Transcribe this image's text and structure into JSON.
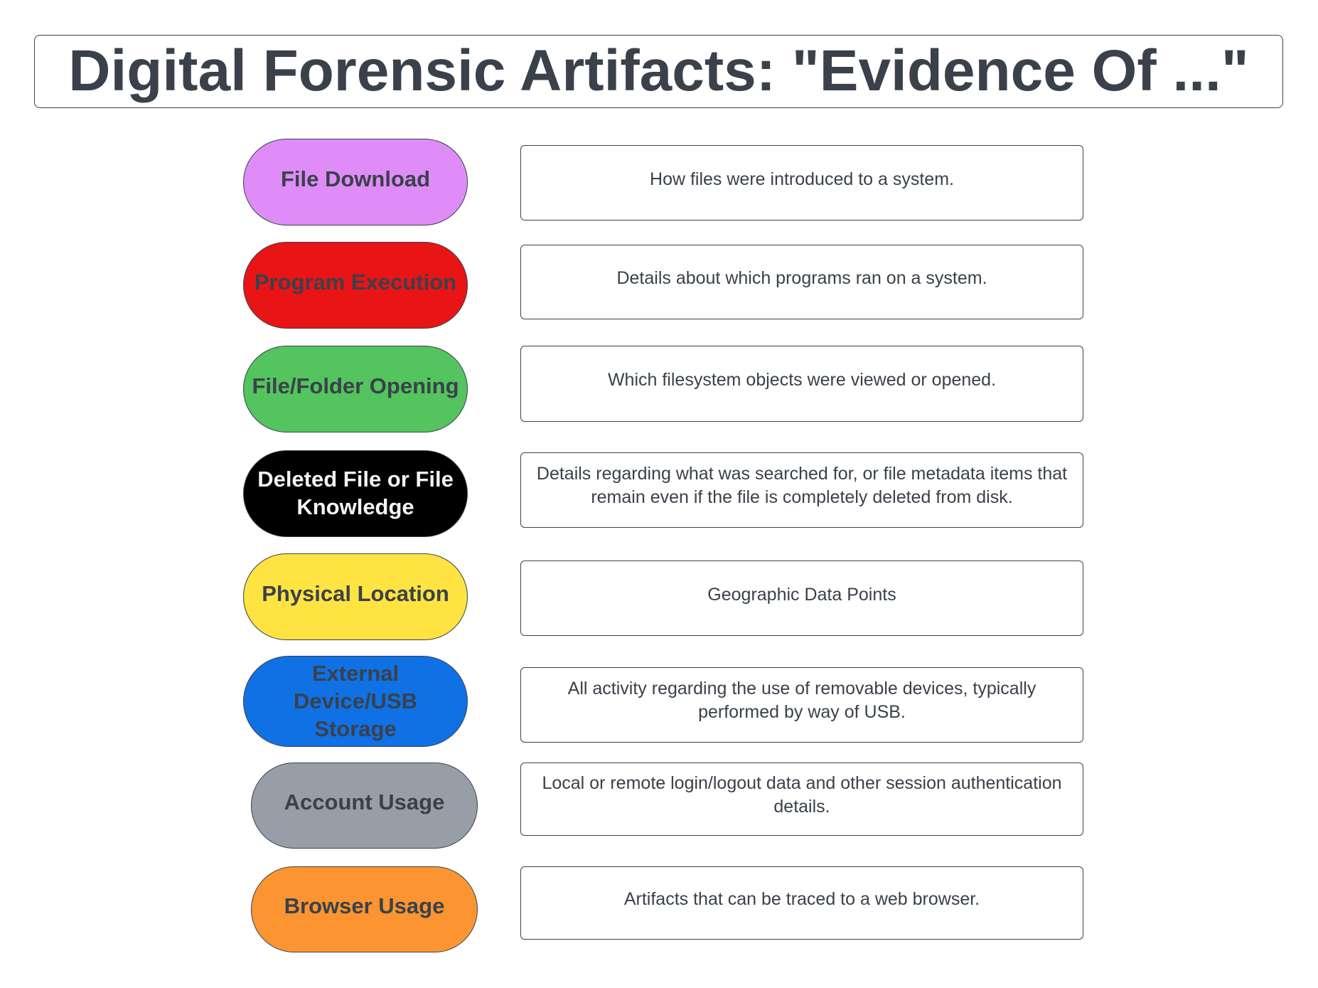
{
  "title": "Digital Forensic Artifacts: \"Evidence Of ...\"",
  "artifacts": [
    {
      "category": "File Download",
      "color": "#DF8CF9",
      "description": "How files were introduced to a system."
    },
    {
      "category": "Program Execution",
      "color": "#E81416",
      "description": "Details about which programs ran on a system."
    },
    {
      "category": "File/Folder Opening",
      "color": "#54C45E",
      "description": "Which filesystem objects were viewed or opened."
    },
    {
      "category": "Deleted File or File Knowledge",
      "color": "#000000",
      "description": "Details regarding what was searched for, or file metadata items that remain even if the file is completely deleted from disk."
    },
    {
      "category": "Physical Location",
      "color": "#FFE342",
      "description": "Geographic Data Points"
    },
    {
      "category": "External Device/USB Storage",
      "color": "#1071E5",
      "description": "All activity regarding the use of removable devices, typically performed by way of USB."
    },
    {
      "category": "Account Usage",
      "color": "#979EA8",
      "description": "Local or remote login/logout data and other session authentication details."
    },
    {
      "category": "Browser Usage",
      "color": "#FC9432",
      "description": "Artifacts that can be traced to a web browser."
    }
  ]
}
